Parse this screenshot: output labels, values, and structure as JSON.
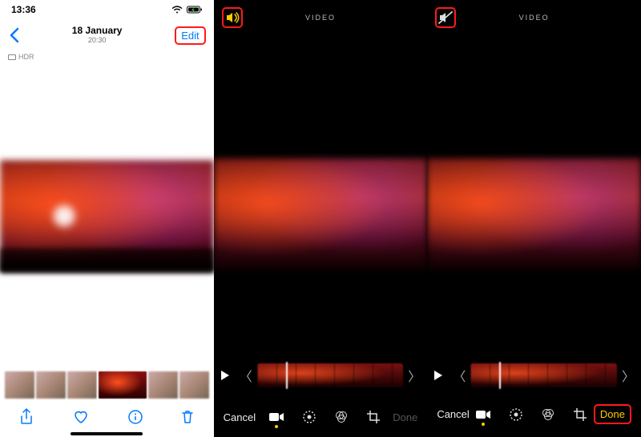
{
  "panel1": {
    "status_time": "13:36",
    "title_date": "18 January",
    "title_time": "20:30",
    "edit_label": "Edit",
    "hdr_label": "HDR"
  },
  "panel2": {
    "header_label": "VIDEO",
    "cancel_label": "Cancel",
    "done_label": "Done",
    "sound_state": "on"
  },
  "panel3": {
    "header_label": "VIDEO",
    "cancel_label": "Cancel",
    "done_label": "Done",
    "sound_state": "muted"
  },
  "colors": {
    "ios_blue": "#007aff",
    "highlight_red": "#ff1a1a",
    "done_yellow": "#ffcc00"
  }
}
